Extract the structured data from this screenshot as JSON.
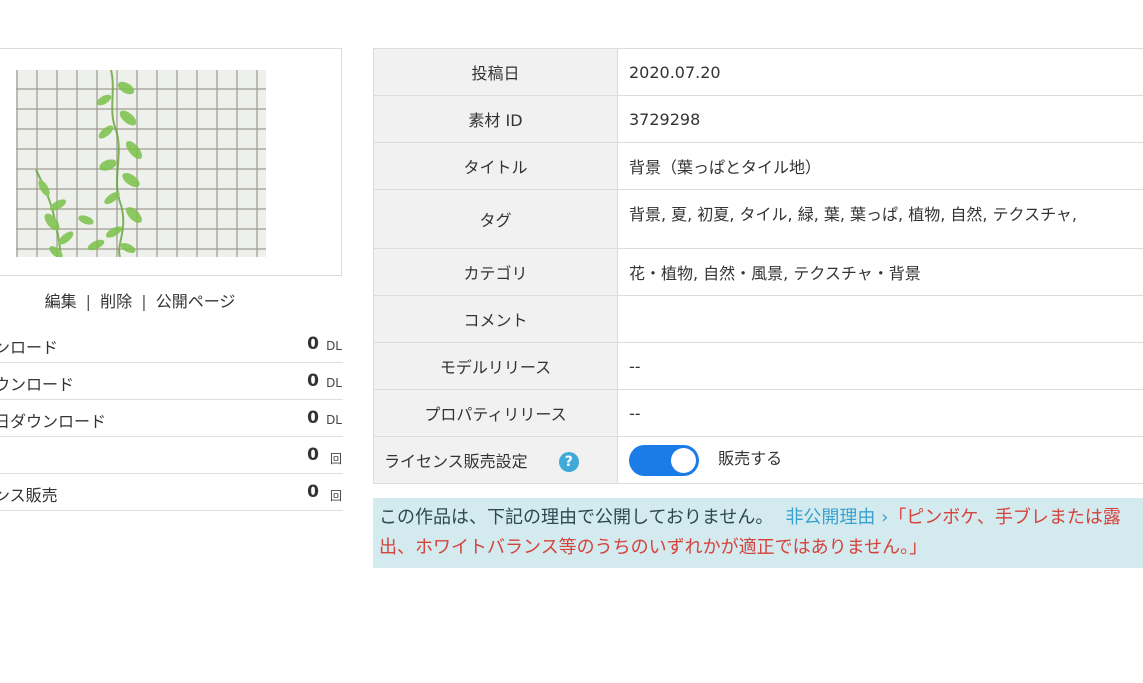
{
  "actions": {
    "edit": "編集",
    "sep1": "|",
    "delete": "削除",
    "sep2": "|",
    "public_page": "公開ページ"
  },
  "stats": [
    {
      "label": "ンロード",
      "value": "0",
      "unit": "DL"
    },
    {
      "label": "ウンロード",
      "value": "0",
      "unit": "DL"
    },
    {
      "label": "日ダウンロード",
      "value": "0",
      "unit": "DL"
    },
    {
      "label": "",
      "value": "0",
      "unit": "回"
    },
    {
      "label": "ンス販売",
      "value": "0",
      "unit": "回"
    }
  ],
  "info": {
    "post_date": {
      "label": "投稿日",
      "value": "2020.07.20"
    },
    "material_id": {
      "label": "素材 ID",
      "value": "3729298"
    },
    "title": {
      "label": "タイトル",
      "value": "背景（葉っぱとタイル地）"
    },
    "tags": {
      "label": "タグ",
      "value": "背景, 夏, 初夏, タイル, 緑, 葉, 葉っぱ, 植物, 自然, テクスチャ,",
      "expand_icon": "triangle-down-icon"
    },
    "category": {
      "label": "カテゴリ",
      "value": "花・植物, 自然・風景, テクスチャ・背景"
    },
    "comment": {
      "label": "コメント",
      "value": ""
    },
    "model_release": {
      "label": "モデルリリース",
      "value": "--"
    },
    "property_release": {
      "label": "プロパティリリース",
      "value": "--"
    },
    "license": {
      "label": "ライセンス販売設定",
      "help_icon": "?",
      "toggle_on": true,
      "toggle_label": "販売する"
    }
  },
  "notice": {
    "message": "この作品は、下記の理由で公開しておりません。",
    "link": "非公開理由 ›",
    "reason": "「ピンボケ、手ブレまたは露出、ホワイトバランス等のうちのいずれかが適正ではありません。」"
  },
  "colors": {
    "accent_blue": "#1b7ce8",
    "help_blue": "#3fa9d8",
    "notice_bg": "#d3eaef",
    "reason_red": "#d6423c",
    "header_bg": "#f1f1f1"
  }
}
